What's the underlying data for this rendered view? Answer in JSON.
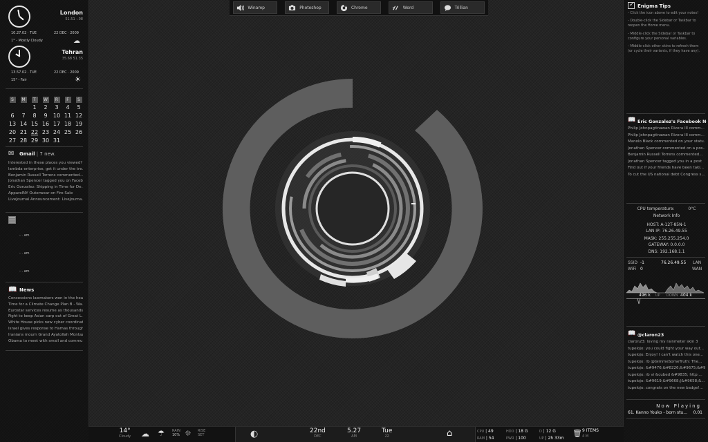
{
  "dock": {
    "items": [
      {
        "label": "Winamp",
        "icon": "speaker-icon"
      },
      {
        "label": "Photoshop",
        "icon": "camera-icon"
      },
      {
        "label": "Chrome",
        "icon": "chrome-icon"
      },
      {
        "label": "Word",
        "icon": "word-icon"
      },
      {
        "label": "Trillian",
        "icon": "chat-bubble-icon"
      }
    ]
  },
  "clocks": [
    {
      "city": "London",
      "coords": "51.51  -.08",
      "time": "10.27.02",
      "day": "TUE",
      "date": "22 DEC",
      "year": "2009",
      "weather": "1° - Mostly Cloudy"
    },
    {
      "city": "Tehran",
      "coords": "35.68  51.35",
      "time": "13.57.02",
      "day": "TUE",
      "date": "22 DEC",
      "year": "2009",
      "weather": "15° - Fair"
    }
  ],
  "calendar": {
    "headers": [
      "S",
      "M",
      "T",
      "W",
      "R",
      "F",
      "S"
    ],
    "weeks": [
      [
        "",
        "",
        "1",
        "2",
        "3",
        "4",
        "5"
      ],
      [
        "6",
        "7",
        "8",
        "9",
        "10",
        "11",
        "12"
      ],
      [
        "13",
        "14",
        "15",
        "16",
        "17",
        "18",
        "19"
      ],
      [
        "20",
        "21",
        "22",
        "23",
        "24",
        "25",
        "26"
      ],
      [
        "27",
        "28",
        "29",
        "30",
        "31",
        "",
        ""
      ]
    ]
  },
  "gmail": {
    "title": "Gmail",
    "count": "7 new.",
    "items": [
      "Interested in these places you viewed?",
      "lambda enterprise, get it under the tre...",
      "Benjamin Russell Torrens commented...",
      "Jonathan Spencer tagged you on Faceb...",
      "Eric Gonzalez: Shipping in Time for De...",
      "ApparelNY Outerwear on Fire Sale",
      "LiveJournal Announcement: LiveJourna..."
    ]
  },
  "alarms": [
    "- . am",
    "- . am",
    "- . am"
  ],
  "news": {
    "title": "News",
    "items": [
      "Concessions lawmakers won in the heal...",
      "Time for a Climate Change Plan B - Wa...",
      "Eurostar services resume as thousands...",
      "Fight to keep Asian carp out of Great L...",
      "White House picks new cyber coordinat...",
      "Israel gives response to Hamas through...",
      "Iranians mourn Grand Ayatollah Montaz...",
      "Obama to meet with small and commu..."
    ]
  },
  "tips": {
    "title": "Enigma Tips",
    "lines": [
      "- Click the icon above to edit your notes!",
      "",
      "- Double-click the Sidebar or Taskbar to",
      "reopen the Home menu.",
      "",
      "- Middle-click the Sidebar or Taskbar to",
      "configure your personal variables.",
      "",
      "- Middle-click other skins to refresh them",
      "(or cycle their variants, if they have any)."
    ]
  },
  "facebook": {
    "title": "Eric Gonzalez's Facebook Noti",
    "items": [
      "Philip Johnpagtinawan Rivera III comm...",
      "Philip Johnpagtinawan Rivera III comm...",
      "Manolo Black commented on your statu...",
      "Jonathan Spencer commented on a pos...",
      "Benjamin Russell Torrens commented...",
      "Jonathan Spencer tagged you in a post",
      "Find out if your friends have been taki...",
      "To cut the US national debt Congress s..."
    ]
  },
  "network": {
    "cpu_temp_label": "CPU temperature:",
    "cpu_temp": "0°C",
    "title": "Network Info",
    "host": "HOST: A-12T-85N-1",
    "lan_ip": "LAN IP: 76.26.49.55",
    "mask": "MASK: 255.255.254.0",
    "gateway": "GATEWAY: 0.0.0.0",
    "dns": "DNS: 192.168.1.1",
    "ssid_label": "SSID",
    "ssid": "-1",
    "wan_ip": "76.26.49.55",
    "lan_label": "LAN",
    "wifi_label": "WiFi",
    "wifi": "0",
    "wan_label": "WAN",
    "up_val": "496 k",
    "up_label": "UP",
    "down_label": "DOWN",
    "down_val": "404 k"
  },
  "twitter": {
    "title": "@claron23",
    "items": [
      "claron23: loving my rainmeter skin 3",
      "tupelojo: you could fight your way out...",
      "tupelojo: Enjoy! I can't watch this one...",
      "tupelojo: rb @GimmeSomeTruth: The...",
      "tupelojo: &#9476;&#8226;&#9675;&#9675;...",
      "tupelojo: rb vi &cubed &#9835; http:...",
      "tupelojo: &#9619;&#9668;|&#9658;&...",
      "tupelojo: congrats on the new badge!..."
    ]
  },
  "now_playing": {
    "title": "Now Playing",
    "track": "61. Kanno Youko - born stu...",
    "time": "0.01"
  },
  "taskbar": {
    "temp": "14°",
    "condition": "Cloudy",
    "rain_label": "RAIN",
    "rain": "10%",
    "rise_label": "RISE",
    "set_label": "SET",
    "day": "22nd",
    "month": "DEC",
    "time": "5.27",
    "ampm": "AM",
    "weekday": "Tue",
    "daynum": "22",
    "cpu_label": "CPU",
    "cpu": "49",
    "ram_label": "RAM",
    "ram": "54",
    "hdd_label": "HDD",
    "hdd": "18 G",
    "pwr_label": "PWR",
    "pwr": "100",
    "d_label": "D",
    "d": "12 G",
    "up_label": "UP",
    "uptime": "2h 33m",
    "items": "9 ITEMS",
    "items_size": "4 M"
  }
}
